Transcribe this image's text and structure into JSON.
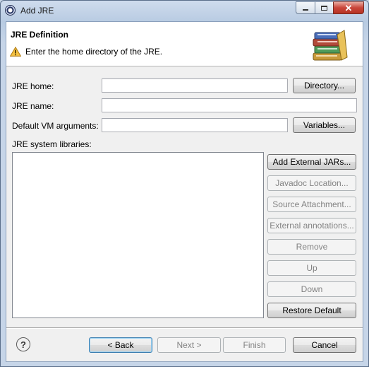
{
  "window": {
    "title": "Add JRE"
  },
  "header": {
    "title": "JRE Definition",
    "message": "Enter the home directory of the JRE."
  },
  "form": {
    "jre_home_label": "JRE home:",
    "jre_home_value": "",
    "directory_button": "Directory...",
    "jre_name_label": "JRE name:",
    "jre_name_value": "",
    "vm_args_label": "Default VM arguments:",
    "vm_args_value": "",
    "variables_button": "Variables...",
    "libraries_label": "JRE system libraries:"
  },
  "library_buttons": [
    {
      "label": "Add External JARs...",
      "enabled": true
    },
    {
      "label": "Javadoc Location...",
      "enabled": false
    },
    {
      "label": "Source Attachment...",
      "enabled": false
    },
    {
      "label": "External annotations...",
      "enabled": false
    },
    {
      "label": "Remove",
      "enabled": false
    },
    {
      "label": "Up",
      "enabled": false
    },
    {
      "label": "Down",
      "enabled": false
    },
    {
      "label": "Restore Default",
      "enabled": true
    }
  ],
  "footer": {
    "back": "< Back",
    "next": "Next >",
    "finish": "Finish",
    "cancel": "Cancel"
  },
  "icons": {
    "app": "eclipse-icon",
    "warning": "warning-icon",
    "banner": "books-icon",
    "help": "help-icon"
  }
}
